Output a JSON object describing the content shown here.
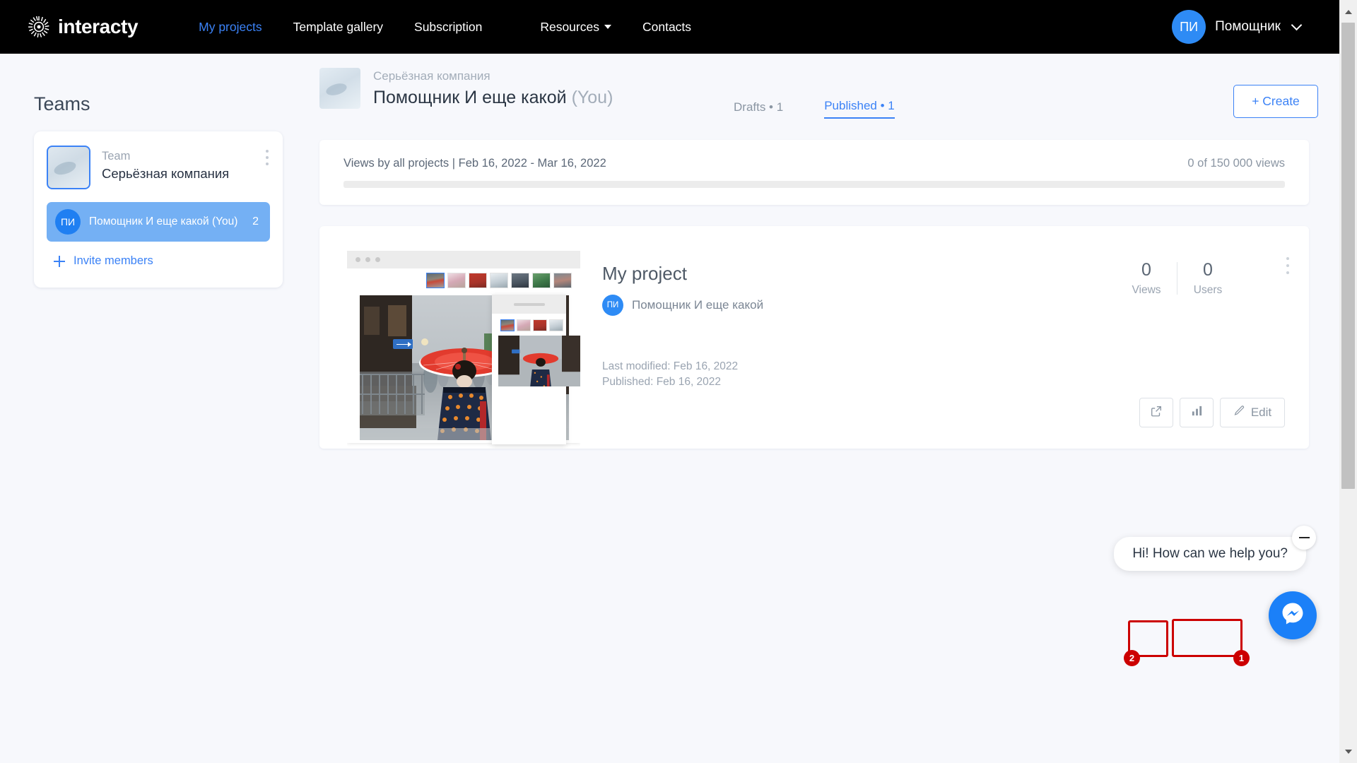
{
  "header": {
    "logo_text": "interacty",
    "nav": [
      {
        "label": "My projects",
        "active": true
      },
      {
        "label": "Template gallery",
        "active": false
      },
      {
        "label": "Subscription",
        "active": false
      },
      {
        "label": "Resources",
        "active": false,
        "has_caret": true
      },
      {
        "label": "Contacts",
        "active": false
      }
    ],
    "user": {
      "initials": "ПИ",
      "name": "Помощник"
    },
    "accent_color": "#3b82f6",
    "avatar_color": "#2e8bf5"
  },
  "sidebar": {
    "title": "Teams",
    "team": {
      "label": "Team",
      "name": "Серьёзная компания"
    },
    "member": {
      "initials": "ПИ",
      "name": "Помощник И еще какой (You)",
      "count": "2"
    },
    "invite_label": "Invite members"
  },
  "project_header": {
    "breadcrumb": "Серьёзная компания",
    "title": "Помощник И еще какой",
    "you_suffix": "(You)",
    "tabs": [
      {
        "label": "Drafts • 1",
        "active": false
      },
      {
        "label": "Published • 1",
        "active": true
      }
    ],
    "create_label": "+ Create"
  },
  "views_panel": {
    "label": "Views by all projects | Feb 16, 2022 - Mar 16, 2022",
    "quota": "0 of 150 000 views",
    "progress_percent": 0
  },
  "project_card": {
    "title": "My project",
    "author_initials": "ПИ",
    "author": "Помощник И еще какой",
    "stats": [
      {
        "value": "0",
        "label": "Views"
      },
      {
        "value": "0",
        "label": "Users"
      }
    ],
    "last_modified": "Last modified: Feb 16, 2022",
    "published": "Published: Feb 16, 2022",
    "actions": {
      "open_icon": "external-link-icon",
      "stats_icon": "bar-chart-icon",
      "edit_label": "Edit",
      "edit_icon": "pencil-icon"
    },
    "annotations": [
      {
        "number": "1",
        "target": "edit-button"
      },
      {
        "number": "2",
        "target": "statistics-button"
      }
    ]
  },
  "chat_widget": {
    "message": "Hi! How can we help you?",
    "minimize_icon": "minus-icon",
    "launcher_icon": "messenger-icon",
    "launcher_color": "#1b80f8"
  }
}
